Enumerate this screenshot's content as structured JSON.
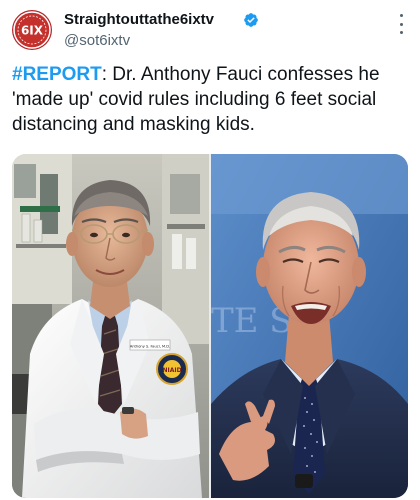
{
  "tweet": {
    "display_name": "Straightouttathe6ixtv",
    "handle": "@sot6ixtv",
    "verified_icon": "verified-badge-icon",
    "more_icon": "more-options-icon",
    "hashtag": "#REPORT",
    "body": ": Dr. Anthony Fauci confesses he 'made up' covid rules including 6 feet social distancing and masking kids."
  },
  "avatar": {
    "logo_text": "6IX"
  },
  "media": {
    "left_photo": {
      "name_tag": "Anthony S. Fauci, M.D.",
      "patch_text": "NIAID"
    },
    "right_photo": {
      "backdrop_text": "TE  SE"
    }
  },
  "colors": {
    "accent": "#1d9bf0",
    "text": "#0f1419",
    "secondary_text": "#536471",
    "avatar_bg": "#b3282d"
  }
}
